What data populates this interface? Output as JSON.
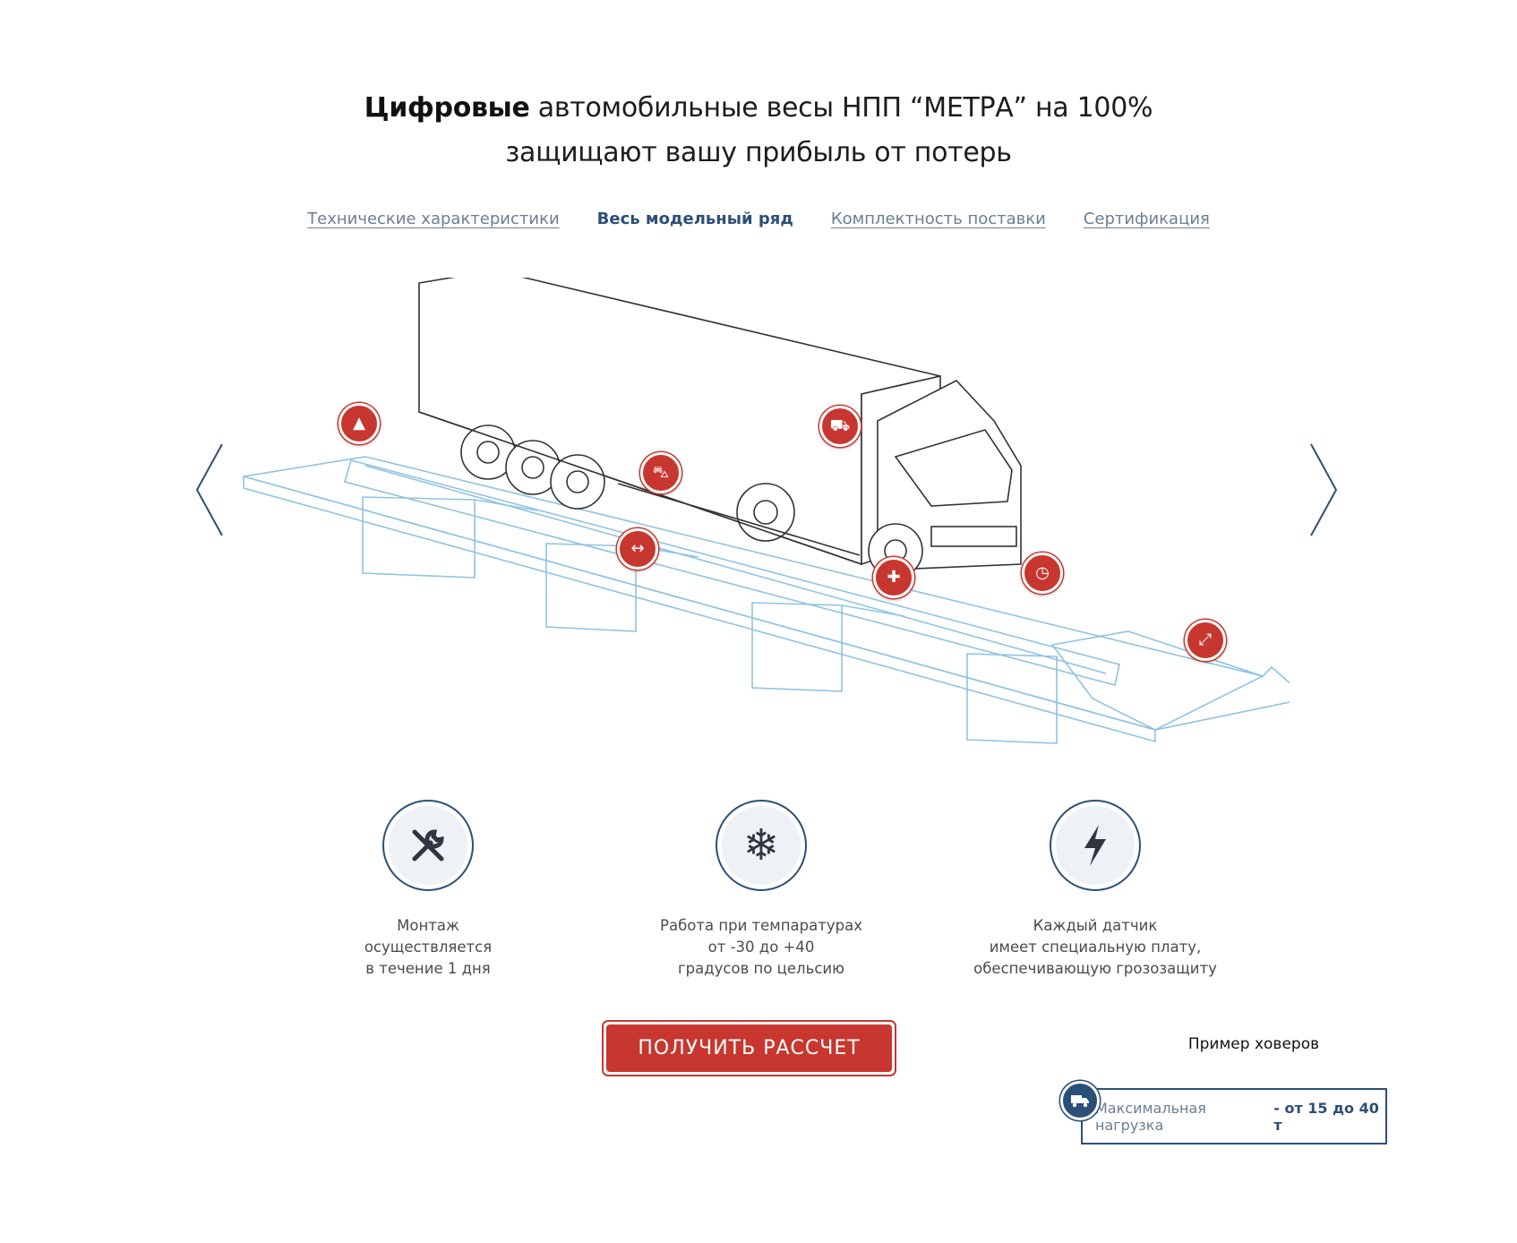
{
  "headline": {
    "bold": "Цифровые",
    "line1_rest": " автомобильные весы НПП “МЕТРА” на 100%",
    "line2": "защищают вашу прибыль от потерь"
  },
  "tabs": [
    {
      "label": "Технические характеристики",
      "active": false
    },
    {
      "label": "Весь модельный ряд",
      "active": true
    },
    {
      "label": "Комплектность поставки",
      "active": false
    },
    {
      "label": "Сертификация",
      "active": false
    }
  ],
  "hotspots": [
    {
      "icon": "road-icon",
      "glyph": "▲"
    },
    {
      "icon": "truck-icon",
      "glyph": "⛟"
    },
    {
      "icon": "car-icon",
      "glyph": "⛍"
    },
    {
      "icon": "width-arrows-icon",
      "glyph": "↔"
    },
    {
      "icon": "plus-icon",
      "glyph": "✚"
    },
    {
      "icon": "clock-icon",
      "glyph": "◷"
    },
    {
      "icon": "resize-arrows-icon",
      "glyph": "⤢"
    }
  ],
  "features": [
    {
      "icon": "tools-icon",
      "text": "Монтаж\nосуществляется\nв течение 1 дня"
    },
    {
      "icon": "snowflake-icon",
      "text": "Работа при темпаратурах\nот -30 до +40\nградусов по цельсию"
    },
    {
      "icon": "lightning-icon",
      "text": "Каждый датчик\nимеет специальную плату,\nобеспечивающую грозозащиту"
    }
  ],
  "cta_label": "ПОЛУЧИТЬ РАССЧЕТ",
  "hover_example": {
    "title": "Пример ховеров",
    "label": "Максимальная нагрузка",
    "value": "- от 15 до 40 т",
    "icon": "truck-icon"
  },
  "colors": {
    "accent": "#c7372f",
    "navy": "#2c4f78",
    "muted": "#6a7f92",
    "line": "#8fc3e3"
  }
}
